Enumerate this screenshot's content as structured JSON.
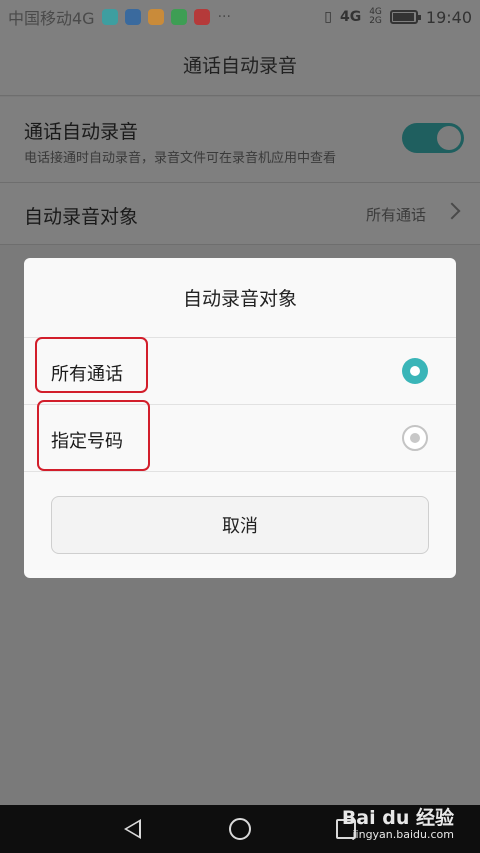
{
  "status_bar": {
    "carrier": "中国移动4G",
    "more": "···",
    "network_label": "4G",
    "network_label_small_top": "4G",
    "network_label_small_bottom": "2G",
    "time": "19:40",
    "battery_level": 0.85,
    "app_icon_colors": [
      "#3e9ea0",
      "#3a6a9e",
      "#c98b3a",
      "#3e9e54",
      "#b53a3a"
    ]
  },
  "page": {
    "title": "通话自动录音"
  },
  "settings": {
    "auto_record": {
      "title": "通话自动录音",
      "subtitle": "电话接通时自动录音，录音文件可在录音机应用中查看",
      "enabled": true
    },
    "record_target": {
      "title": "自动录音对象",
      "value": "所有通话"
    }
  },
  "dialog": {
    "title": "自动录音对象",
    "options": [
      {
        "label": "所有通话",
        "selected": true
      },
      {
        "label": "指定号码",
        "selected": false
      }
    ],
    "cancel_label": "取消"
  },
  "watermark": {
    "brand": "Bai du 经验",
    "url": "jingyan.baidu.com"
  },
  "colors": {
    "accent": "#3ab5b8",
    "highlight_box": "#d21e2b"
  }
}
